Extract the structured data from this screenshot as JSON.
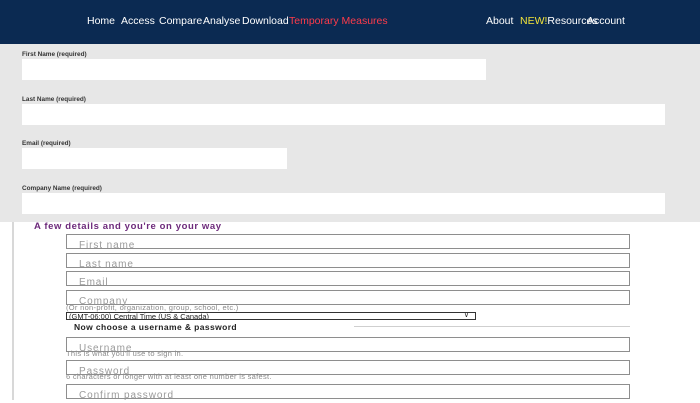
{
  "nav": {
    "left": [
      "Home",
      "Access",
      "Compare",
      "Analyse",
      "Download",
      "Temporary Measures"
    ],
    "right": {
      "about": "About",
      "new_badge": "NEW!",
      "resources": "Resources",
      "account": "Account"
    },
    "active": "Temporary Measures"
  },
  "overlay_form": {
    "first_name_label": "First Name (required)",
    "last_name_label": "Last Name (required)",
    "email_label": "Email (required)",
    "company_label": "Company Name (required)",
    "first_name_value": "",
    "last_name_value": "",
    "email_value": "",
    "company_value": ""
  },
  "signup": {
    "headline": "A few details and you're on your way",
    "first_name_placeholder": "First name",
    "last_name_placeholder": "Last name",
    "email_placeholder": "Email",
    "company_placeholder": "Company",
    "company_hint": "(Or non-profit, organization, group, school, etc.)",
    "timezone_value": "(GMT-06:00) Central Time (US & Canada)",
    "credentials_heading": "Now choose a username & password",
    "username_placeholder": "Username",
    "username_hint": "This is what you'll use to sign in.",
    "password_placeholder": "Password",
    "password_hint": "6 characters or longer with at least one number is safest.",
    "confirm_placeholder": "Confirm password"
  },
  "colors": {
    "nav_bg": "#0b2a52",
    "nav_active": "#ff3b4a",
    "new_badge": "#f1e33a",
    "overlay_bg": "#e7e7e7",
    "headline": "#6d2a7b"
  }
}
